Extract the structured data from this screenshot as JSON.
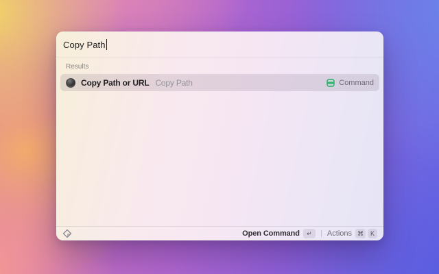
{
  "window": {
    "search": {
      "value": "Copy Path"
    },
    "results": {
      "header": "Results",
      "items": [
        {
          "title": "Copy Path or URL",
          "subtitle": "Copy Path",
          "type_label": "Command",
          "icon": "dark-circle-extension-icon",
          "type_icon": "green-command-icon"
        }
      ]
    },
    "footer": {
      "app_icon": "diamond-extension-icon",
      "primary_action_label": "Open Command",
      "primary_action_key": "↵",
      "actions_label": "Actions",
      "cmd_key": "⌘",
      "k_key": "K"
    }
  },
  "colors": {
    "accent_green": "#1fb364",
    "row_highlight": "rgba(120,104,130,0.18)",
    "bg_yellow": "#f3da62",
    "bg_salmon": "#f79a92",
    "bg_pink": "#e289b4",
    "bg_blue_top": "#6b83ea",
    "bg_blue_bottom": "#5a5ce0",
    "bg_purple": "#9a55cc"
  }
}
